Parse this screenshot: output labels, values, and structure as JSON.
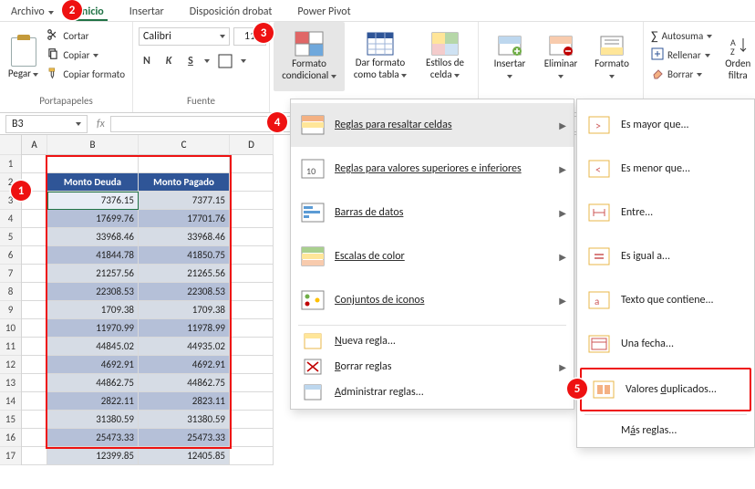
{
  "tabs": {
    "archivo": "Archivo",
    "inicio": "Inicio",
    "insertar": "Insertar",
    "disposicion": "Disposición drobat",
    "powerpivot": "Power Pivot"
  },
  "clipboard": {
    "paste": "Pegar",
    "cut": "Cortar",
    "copy": "Copiar",
    "painter": "Copiar formato",
    "group": "Portapapeles"
  },
  "font": {
    "name": "Calibri",
    "size": "11",
    "group": "Fuente"
  },
  "styles": {
    "cf": "Formato condicional",
    "cf1": "Formato",
    "cf2": "condicional",
    "fat1": "Dar formato",
    "fat2": "como tabla",
    "cs1": "Estilos de",
    "cs2": "celda"
  },
  "cells": {
    "insert": "Insertar",
    "delete": "Eliminar",
    "format": "Formato"
  },
  "edit": {
    "autosum": "Autosuma",
    "fill": "Rellenar",
    "clear": "Borrar",
    "sort1": "Orden",
    "sort2": "filtra"
  },
  "namebox": "B3",
  "callouts": {
    "c1": "1",
    "c2": "2",
    "c3": "3",
    "c4": "4",
    "c5": "5"
  },
  "headers": {
    "colA": "A",
    "colB": "B",
    "colC": "C",
    "colD": "D"
  },
  "table_headers": {
    "b": "Monto Deuda",
    "c": "Monto Pagado"
  },
  "rows": [
    {
      "r": 3,
      "b": "7376.15",
      "c": "7377.15"
    },
    {
      "r": 4,
      "b": "17699.76",
      "c": "17701.76"
    },
    {
      "r": 5,
      "b": "33968.46",
      "c": "33968.46"
    },
    {
      "r": 6,
      "b": "41844.78",
      "c": "41850.75"
    },
    {
      "r": 7,
      "b": "21257.56",
      "c": "21265.56"
    },
    {
      "r": 8,
      "b": "22308.53",
      "c": "22308.53"
    },
    {
      "r": 9,
      "b": "1709.38",
      "c": "1709.38"
    },
    {
      "r": 10,
      "b": "11970.99",
      "c": "11978.99"
    },
    {
      "r": 11,
      "b": "44845.02",
      "c": "44935.02"
    },
    {
      "r": 12,
      "b": "4692.91",
      "c": "4692.91"
    },
    {
      "r": 13,
      "b": "44862.75",
      "c": "44862.75"
    },
    {
      "r": 14,
      "b": "2822.11",
      "c": "2823.11"
    },
    {
      "r": 15,
      "b": "31380.59",
      "c": "31380.59"
    },
    {
      "r": 16,
      "b": "25473.33",
      "c": "25473.33"
    },
    {
      "r": 17,
      "b": "12399.85",
      "c": "12405.85"
    }
  ],
  "cf_menu": {
    "highlight": "Reglas para resaltar celdas",
    "toprules": "Reglas para valores superiores e inferiores",
    "databars": "Barras de datos",
    "colorscales": "Escalas de color",
    "iconsets": "Conjuntos de iconos",
    "newrule_pre": "N",
    "newrule_rest": "ueva regla...",
    "clear_pre": "B",
    "clear_rest": "orrar reglas",
    "manage_pre": "A",
    "manage_rest": "dministrar reglas..."
  },
  "hl_menu": {
    "gt": "Es mayor que...",
    "lt": "Es menor que...",
    "between": "Entre...",
    "eq": "Es igual a...",
    "text": "Texto que contiene...",
    "date": "Una fecha...",
    "dup_pre": "Valores ",
    "dup_u": "d",
    "dup_post": "uplicados...",
    "more_pre": "M",
    "more_u": "á",
    "more_post": "s reglas..."
  }
}
